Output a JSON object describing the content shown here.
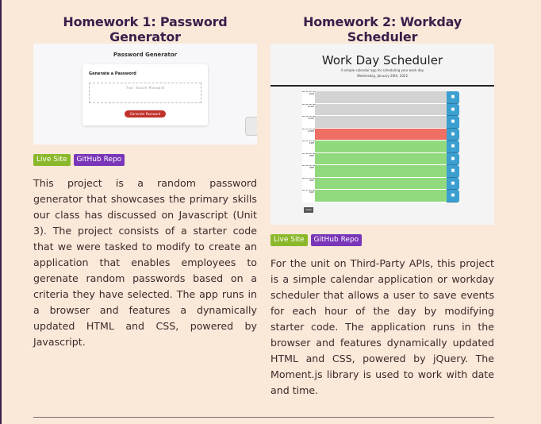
{
  "projects": [
    {
      "title": "Homework 1: Password Generator",
      "live_label": "Live Site",
      "repo_label": "GitHub Repo",
      "description": "This project is a random password generator that showcases the primary skills our class has discussed on Javascript (Unit 3). The project consists of a starter code that we were tasked to modify to create an application that enables employees to gerenate random passwords based on a criteria they have selected. The app runs in a browser and features a dynamically updated HTML and CSS, powered by Javascript.",
      "preview": {
        "app_title": "Password Generator",
        "card_heading": "Generate a Password",
        "textarea_placeholder": "Your Secure Password",
        "button_label": "Generate Password"
      }
    },
    {
      "title": "Homework 2: Workday Scheduler",
      "live_label": "Live Site",
      "repo_label": "GitHub Repo",
      "description": "For the unit on Third-Party APIs, this project is a simple calendar application or workday scheduler that allows a user to save events for each hour of the day by modifying starter code. The application runs in the browser and features dynamically updated HTML and CSS, powered by jQuery. The Moment.js library is used to work with date and time.",
      "preview": {
        "app_title": "Work Day Scheduler",
        "subtitle": "A simple calendar app for scheduling your work day",
        "date": "Wednesday, January 26th, 2022",
        "clear_label": "Clear",
        "hours": [
          {
            "label": "9AM",
            "state": "past"
          },
          {
            "label": "10AM",
            "state": "past"
          },
          {
            "label": "11AM",
            "state": "past"
          },
          {
            "label": "12PM",
            "state": "present"
          },
          {
            "label": "1PM",
            "state": "future"
          },
          {
            "label": "2PM",
            "state": "future"
          },
          {
            "label": "3PM",
            "state": "future"
          },
          {
            "label": "4PM",
            "state": "future"
          },
          {
            "label": "5PM",
            "state": "future"
          }
        ]
      }
    }
  ],
  "colors": {
    "background": "#fae8d9",
    "heading": "#3a1f4a",
    "live_badge": "#8bb82b",
    "repo_badge": "#7a36b8"
  }
}
